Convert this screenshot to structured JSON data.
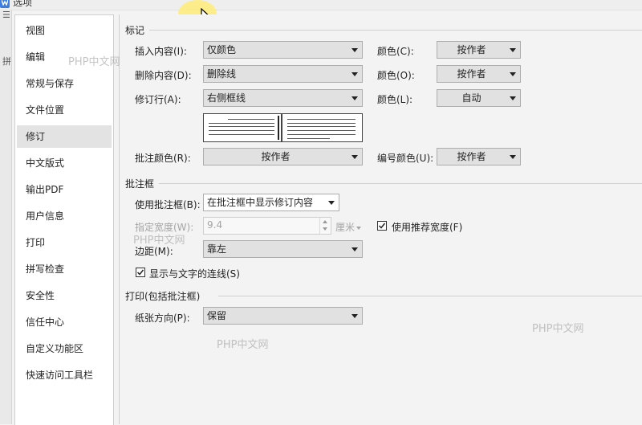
{
  "window": {
    "title": "选项"
  },
  "left_strip": {
    "glyphs": [
      "☰",
      "拼"
    ]
  },
  "sidebar": {
    "items": [
      {
        "label": "视图",
        "active": false
      },
      {
        "label": "编辑",
        "active": false
      },
      {
        "label": "常规与保存",
        "active": false
      },
      {
        "label": "文件位置",
        "active": false
      },
      {
        "label": "修订",
        "active": true
      },
      {
        "label": "中文版式",
        "active": false
      },
      {
        "label": "输出PDF",
        "active": false
      },
      {
        "label": "用户信息",
        "active": false
      },
      {
        "label": "打印",
        "active": false
      },
      {
        "label": "拼写检查",
        "active": false
      },
      {
        "label": "安全性",
        "active": false
      },
      {
        "label": "信任中心",
        "active": false
      },
      {
        "label": "自定义功能区",
        "active": false
      },
      {
        "label": "快速访问工具栏",
        "active": false
      }
    ]
  },
  "markup": {
    "section_title": "标记",
    "insert_label": "插入内容(I):",
    "insert_value": "仅颜色",
    "insert_color_label": "颜色(C):",
    "insert_color_value": "按作者",
    "delete_label": "删除内容(D):",
    "delete_value": "删除线",
    "delete_color_label": "颜色(O):",
    "delete_color_value": "按作者",
    "revline_label": "修订行(A):",
    "revline_value": "右侧框线",
    "revline_color_label": "颜色(L):",
    "revline_color_value": "自动",
    "comment_color_label": "批注颜色(R):",
    "comment_color_value": "按作者",
    "number_color_label": "编号颜色(U):",
    "number_color_value": "按作者"
  },
  "balloon": {
    "section_title": "批注框",
    "use_label": "使用批注框(B):",
    "use_value": "在批注框中显示修订内容",
    "width_label": "指定宽度(W):",
    "width_value": "9.4",
    "width_unit": "厘米",
    "recommended_label": "使用推荐宽度(F)",
    "recommended_checked": true,
    "margin_label": "边距(M):",
    "margin_value": "靠左",
    "show_lines_label": "显示与文字的连线(S)",
    "show_lines_checked": true
  },
  "print": {
    "section_title": "打印(包括批注框)",
    "orientation_label": "纸张方向(P):",
    "orientation_value": "保留"
  },
  "watermarks": [
    "PHP中文网",
    "PHP中文网",
    "PHP中文网",
    "PHP中文网"
  ]
}
